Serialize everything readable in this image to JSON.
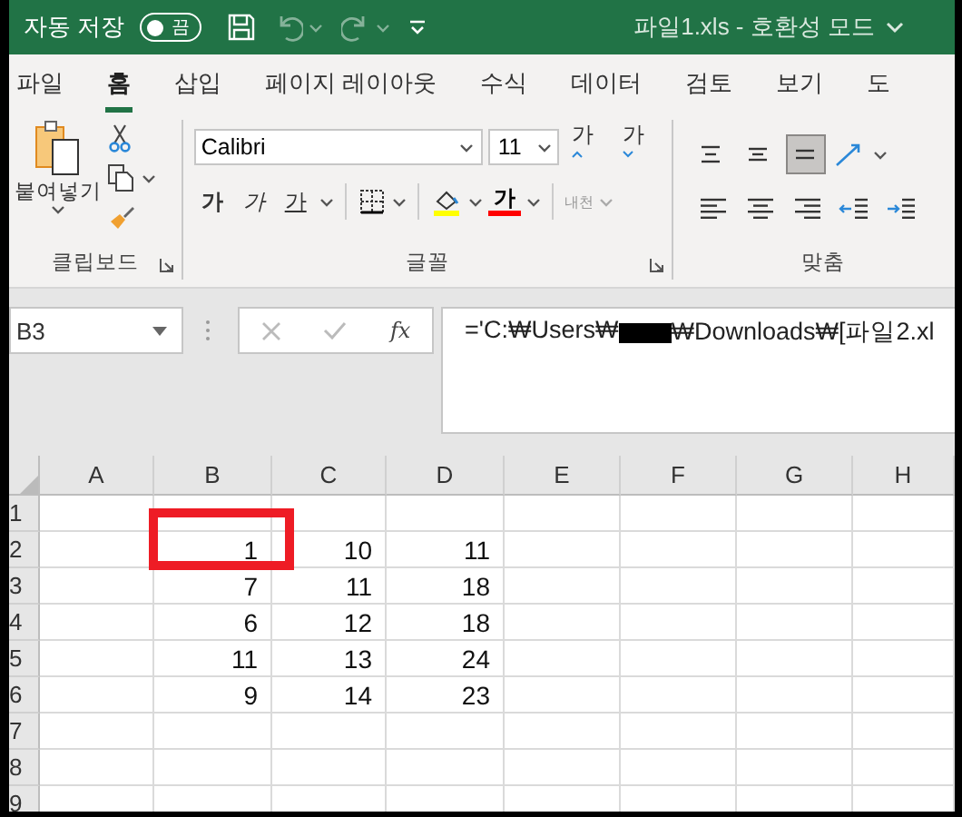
{
  "title_bar": {
    "autosave_label": "자동 저장",
    "autosave": {
      "on": false,
      "label": "끔"
    },
    "quick_access": [
      {
        "kind": "save",
        "disabled": false
      },
      {
        "kind": "undo",
        "disabled": true
      },
      {
        "kind": "redo",
        "disabled": true
      },
      {
        "kind": "customize",
        "disabled": false
      }
    ],
    "title": "파일1.xls  -  호환성 모드"
  },
  "tabs": [
    {
      "label": "파일",
      "selected": false
    },
    {
      "label": "홈",
      "selected": true
    },
    {
      "label": "삽입",
      "selected": false
    },
    {
      "label": "페이지 레이아웃",
      "selected": false
    },
    {
      "label": "수식",
      "selected": false
    },
    {
      "label": "데이터",
      "selected": false
    },
    {
      "label": "검토",
      "selected": false
    },
    {
      "label": "보기",
      "selected": false
    },
    {
      "label": "도",
      "selected": false
    }
  ],
  "ribbon": {
    "clipboard": {
      "paste_label": "붙여넣기",
      "group_label": "클립보드"
    },
    "font": {
      "name": "Calibri",
      "size": "11",
      "grow": "가",
      "shrink": "가",
      "bold": "가",
      "italic": "가",
      "underline": "가",
      "font_color": "가",
      "phonetic": "내천",
      "group_label": "글꼴"
    },
    "alignment": {
      "group_label": "맞춤",
      "vertical": [
        {
          "kind": "top",
          "selected": false
        },
        {
          "kind": "middle",
          "selected": false
        },
        {
          "kind": "bottom",
          "selected": true
        }
      ]
    }
  },
  "formula_bar": {
    "name_box": "B3",
    "function_label": "fx",
    "formula_start": "='C:₩Users₩",
    "formula_end": "₩Downloads₩[파일2.xl"
  },
  "sheet": {
    "columns": [
      "A",
      "B",
      "C",
      "D",
      "E",
      "F",
      "G",
      "H"
    ],
    "rows": [
      {
        "header": "1",
        "cells": [
          null,
          null,
          null,
          null,
          null,
          null,
          null,
          null
        ]
      },
      {
        "header": "2",
        "cells": [
          null,
          "1",
          "10",
          "11",
          null,
          null,
          null,
          null
        ]
      },
      {
        "header": "3",
        "cells": [
          null,
          "7",
          "11",
          "18",
          null,
          null,
          null,
          null
        ]
      },
      {
        "header": "4",
        "cells": [
          null,
          "6",
          "12",
          "18",
          null,
          null,
          null,
          null
        ]
      },
      {
        "header": "5",
        "cells": [
          null,
          "11",
          "13",
          "24",
          null,
          null,
          null,
          null
        ]
      },
      {
        "header": "6",
        "cells": [
          null,
          "9",
          "14",
          "23",
          null,
          null,
          null,
          null
        ]
      },
      {
        "header": "7",
        "cells": [
          null,
          null,
          null,
          null,
          null,
          null,
          null,
          null
        ]
      },
      {
        "header": "8",
        "cells": [
          null,
          null,
          null,
          null,
          null,
          null,
          null,
          null
        ]
      },
      {
        "header": "9",
        "cells": [
          null,
          null,
          null,
          null,
          null,
          null,
          null,
          null
        ]
      }
    ]
  }
}
